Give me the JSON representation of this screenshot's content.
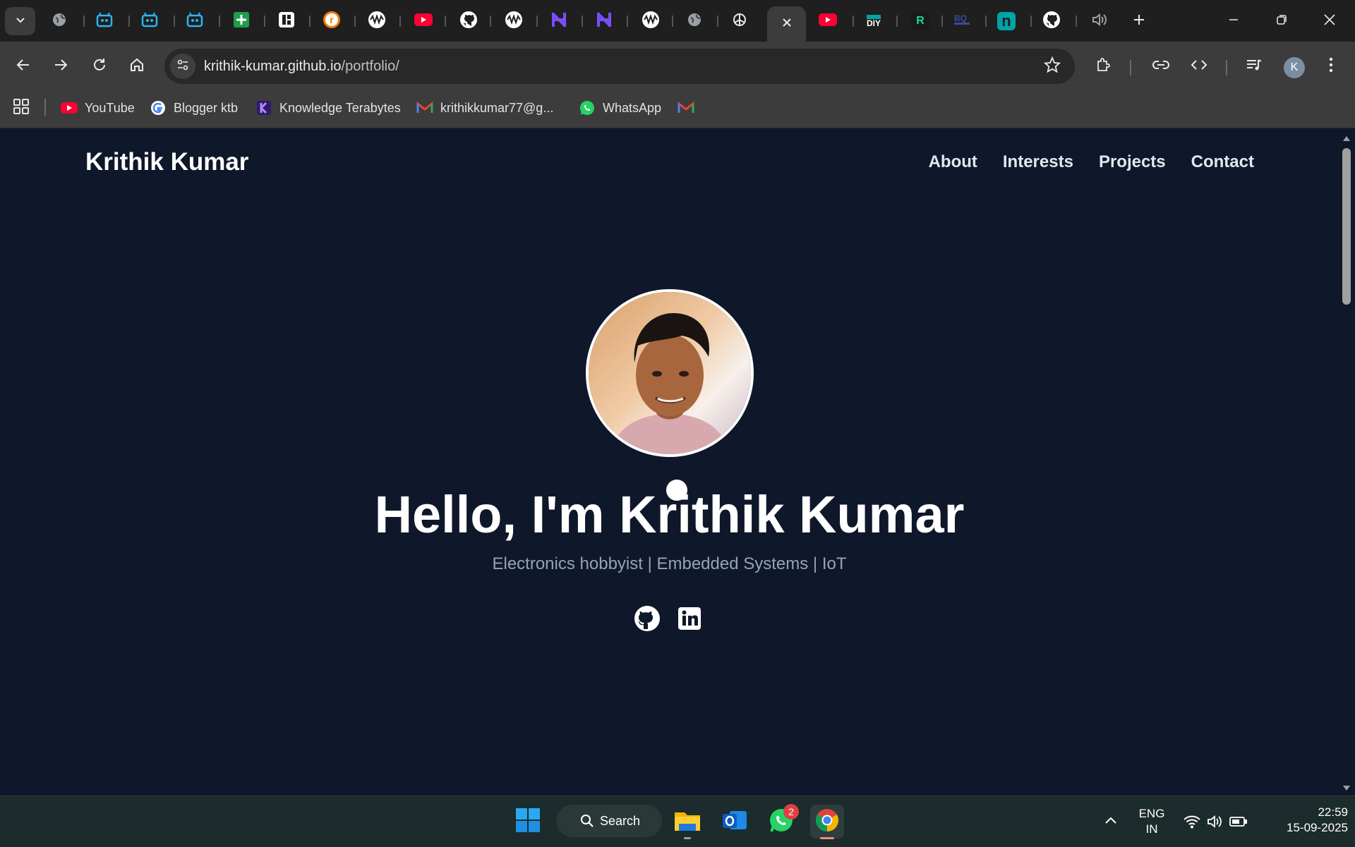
{
  "browser": {
    "tabs": [
      {
        "icon": "globe-icon"
      },
      {
        "icon": "robot-icon"
      },
      {
        "icon": "robot-icon"
      },
      {
        "icon": "robot-icon"
      },
      {
        "icon": "sheets-icon"
      },
      {
        "icon": "app-icon"
      },
      {
        "icon": "r-icon"
      },
      {
        "icon": "wave-icon"
      },
      {
        "icon": "youtube-icon"
      },
      {
        "icon": "github-icon"
      },
      {
        "icon": "wave-icon"
      },
      {
        "icon": "h-icon"
      },
      {
        "icon": "h-icon"
      },
      {
        "icon": "wave-icon"
      },
      {
        "icon": "globe-icon"
      },
      {
        "icon": "openai-icon"
      }
    ],
    "tabs_after": [
      {
        "icon": "youtube-icon"
      },
      {
        "icon": "diy-icon",
        "label": "DIY"
      },
      {
        "icon": "r-icon",
        "label": "R"
      },
      {
        "icon": "bq-icon"
      },
      {
        "icon": "n-icon",
        "label": "n"
      },
      {
        "icon": "github-icon"
      },
      {
        "icon": "speaker-icon"
      }
    ],
    "url_host": "krithik-kumar.github.io",
    "url_path": "/portfolio/",
    "profile_initial": "K",
    "bookmarks": [
      {
        "label": "YouTube",
        "icon": "youtube-icon"
      },
      {
        "label": "Blogger ktb",
        "icon": "google-icon"
      },
      {
        "label": "Knowledge Terabytes",
        "icon": "k-icon"
      },
      {
        "label": "krithikkumar77@g...",
        "icon": "gmail-icon"
      },
      {
        "label": "WhatsApp",
        "icon": "whatsapp-icon"
      },
      {
        "label": "",
        "icon": "gmail-icon"
      }
    ]
  },
  "page": {
    "brand": "Krithik Kumar",
    "nav": [
      "About",
      "Interests",
      "Projects",
      "Contact"
    ],
    "hero_title": "Hello, I'm Krithik Kumar",
    "hero_subtitle": "Electronics hobbyist | Embedded Systems | IoT",
    "social": [
      "github-icon",
      "linkedin-icon"
    ]
  },
  "taskbar": {
    "search_label": "Search",
    "whatsapp_badge": "2",
    "lang_line1": "ENG",
    "lang_line2": "IN",
    "time": "22:59",
    "date": "15-09-2025"
  },
  "colors": {
    "page_bg": "#0f172a",
    "subtitle": "#94a3b8",
    "chrome_bg": "#3c3c3c"
  }
}
